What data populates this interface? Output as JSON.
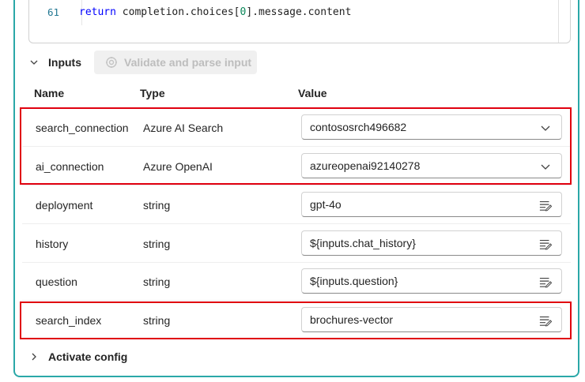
{
  "code": {
    "line_number": "61",
    "keyword": "return",
    "expr_prefix": " completion.choices[",
    "expr_index": "0",
    "expr_suffix": "].message.content"
  },
  "inputs": {
    "title": "Inputs",
    "validate_label": "Validate and parse input"
  },
  "columns": {
    "name": "Name",
    "type": "Type",
    "value": "Value"
  },
  "rows": [
    {
      "name": "search_connection",
      "type": "Azure AI Search",
      "value": "contososrch496682",
      "control": "dropdown"
    },
    {
      "name": "ai_connection",
      "type": "Azure OpenAI",
      "value": "azureopenai92140278",
      "control": "dropdown"
    },
    {
      "name": "deployment",
      "type": "string",
      "value": "gpt-4o",
      "control": "text"
    },
    {
      "name": "history",
      "type": "string",
      "value": "${inputs.chat_history}",
      "control": "text"
    },
    {
      "name": "question",
      "type": "string",
      "value": "${inputs.question}",
      "control": "text"
    },
    {
      "name": "search_index",
      "type": "string",
      "value": "brochures-vector",
      "control": "text"
    }
  ],
  "activate": {
    "label": "Activate config"
  },
  "colors": {
    "accent_frame": "#2aa8a8",
    "highlight": "#e0000f"
  },
  "icons": {
    "inputs_toggle": "chevron-down-icon",
    "validate": "validate-icon",
    "dropdown": "chevron-down-icon",
    "text_edit": "text-edit-icon",
    "activate_toggle": "chevron-right-icon"
  }
}
